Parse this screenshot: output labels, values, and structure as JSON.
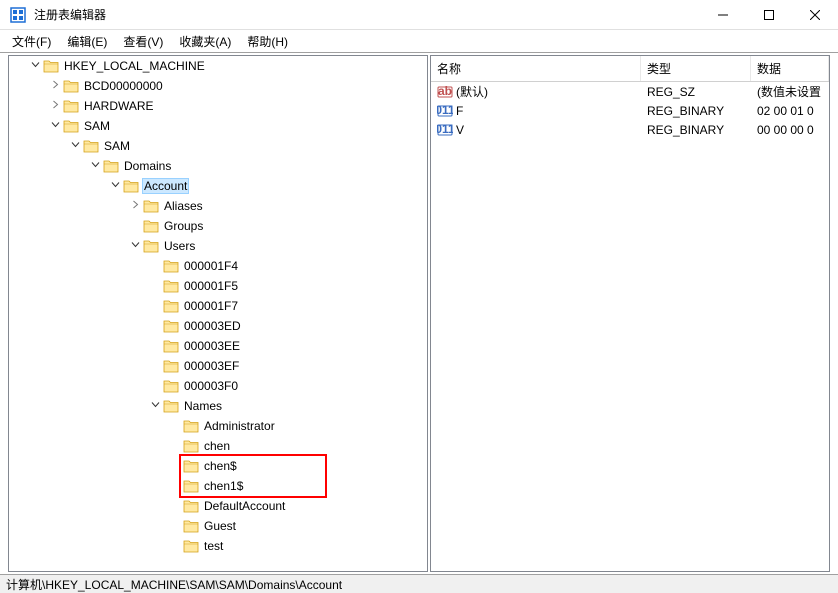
{
  "window": {
    "title": "注册表编辑器"
  },
  "menu": {
    "file": "文件(F)",
    "edit": "编辑(E)",
    "view": "查看(V)",
    "favorites": "收藏夹(A)",
    "help": "帮助(H)"
  },
  "tree": [
    {
      "depth": 0,
      "exp": "open",
      "label": "HKEY_LOCAL_MACHINE",
      "selected": false
    },
    {
      "depth": 1,
      "exp": "closed",
      "label": "BCD00000000"
    },
    {
      "depth": 1,
      "exp": "closed",
      "label": "HARDWARE"
    },
    {
      "depth": 1,
      "exp": "open",
      "label": "SAM"
    },
    {
      "depth": 2,
      "exp": "open",
      "label": "SAM"
    },
    {
      "depth": 3,
      "exp": "open",
      "label": "Domains"
    },
    {
      "depth": 4,
      "exp": "open",
      "label": "Account",
      "selected": true
    },
    {
      "depth": 5,
      "exp": "closed",
      "label": "Aliases"
    },
    {
      "depth": 5,
      "exp": "none",
      "label": "Groups"
    },
    {
      "depth": 5,
      "exp": "open",
      "label": "Users"
    },
    {
      "depth": 6,
      "exp": "none",
      "label": "000001F4"
    },
    {
      "depth": 6,
      "exp": "none",
      "label": "000001F5"
    },
    {
      "depth": 6,
      "exp": "none",
      "label": "000001F7"
    },
    {
      "depth": 6,
      "exp": "none",
      "label": "000003ED"
    },
    {
      "depth": 6,
      "exp": "none",
      "label": "000003EE"
    },
    {
      "depth": 6,
      "exp": "none",
      "label": "000003EF"
    },
    {
      "depth": 6,
      "exp": "none",
      "label": "000003F0"
    },
    {
      "depth": 6,
      "exp": "open",
      "label": "Names"
    },
    {
      "depth": 7,
      "exp": "none",
      "label": "Administrator"
    },
    {
      "depth": 7,
      "exp": "none",
      "label": "chen"
    },
    {
      "depth": 7,
      "exp": "none",
      "label": "chen$",
      "hl": true
    },
    {
      "depth": 7,
      "exp": "none",
      "label": "chen1$",
      "hl": true
    },
    {
      "depth": 7,
      "exp": "none",
      "label": "DefaultAccount"
    },
    {
      "depth": 7,
      "exp": "none",
      "label": "Guest"
    },
    {
      "depth": 7,
      "exp": "none",
      "label": "test"
    }
  ],
  "list": {
    "headers": {
      "name": "名称",
      "type": "类型",
      "data": "数据"
    },
    "rows": [
      {
        "icon": "string",
        "name": "(默认)",
        "type": "REG_SZ",
        "data": "(数值未设置"
      },
      {
        "icon": "binary",
        "name": "F",
        "type": "REG_BINARY",
        "data": "02 00 01 0"
      },
      {
        "icon": "binary",
        "name": "V",
        "type": "REG_BINARY",
        "data": "00 00 00 0"
      }
    ]
  },
  "status": {
    "path": "计算机\\HKEY_LOCAL_MACHINE\\SAM\\SAM\\Domains\\Account"
  },
  "highlight_box": {
    "row_start": 20,
    "row_end": 21
  }
}
